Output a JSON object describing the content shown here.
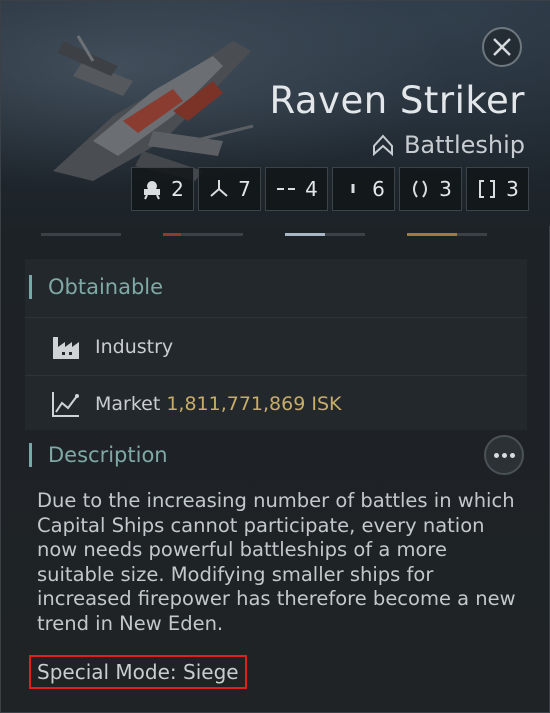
{
  "header": {
    "ship_name": "Raven Striker",
    "ship_class": "Battleship",
    "class_icon": "chevron-up-icon",
    "close_icon": "close-icon"
  },
  "stats": [
    {
      "icon": "turret-icon",
      "value": "2"
    },
    {
      "icon": "drone-icon",
      "value": "7"
    },
    {
      "icon": "dashes-icon",
      "value": "4"
    },
    {
      "icon": "bar-icon",
      "value": "6"
    },
    {
      "icon": "parenthesis-icon",
      "value": "3"
    },
    {
      "icon": "bracket-icon",
      "value": "3"
    }
  ],
  "obtainable": {
    "title": "Obtainable",
    "industry_label": "Industry",
    "market_label": "Market",
    "market_price": "1,811,771,869 ISK"
  },
  "description": {
    "title": "Description",
    "body": "Due to the increasing number of battles in which Capital Ships cannot participate, every nation now needs powerful battleships of a more suitable size. Modifying smaller ships for increased firepower has therefore become a new trend in New Eden.",
    "special_mode": "Special Mode: Siege"
  },
  "colors": {
    "accent_teal": "#7fa9a6",
    "isk_gold": "#c8ad6a",
    "highlight_red": "#e0201d"
  }
}
